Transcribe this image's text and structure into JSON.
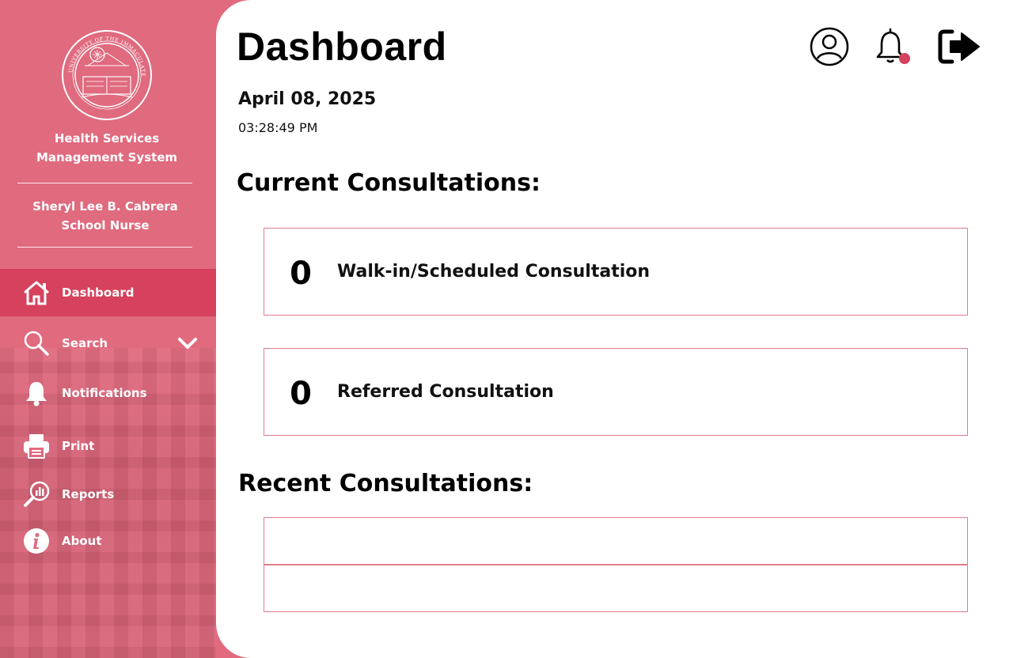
{
  "sidebar": {
    "logo_text": "UNIVERSITY OF THE IMMACULATE CONCEPTION · DAVAO · 1905 · CITY",
    "system_title_line1": "Health Services",
    "system_title_line2": "Management System",
    "user_name": "Sheryl Lee B. Cabrera",
    "user_role": "School Nurse",
    "nav": [
      {
        "label": "Dashboard",
        "icon": "home-icon",
        "active": true
      },
      {
        "label": "Search",
        "icon": "search-icon",
        "active": false
      },
      {
        "label": "Notifications",
        "icon": "bell-icon",
        "active": false
      },
      {
        "label": "Print",
        "icon": "printer-icon",
        "active": false
      },
      {
        "label": "Reports",
        "icon": "reports-icon",
        "active": false
      },
      {
        "label": "About",
        "icon": "info-icon",
        "active": false
      }
    ]
  },
  "header": {
    "title": "Dashboard",
    "icons": [
      "user-profile-icon",
      "notification-bell-icon",
      "logout-icon"
    ]
  },
  "datetime": {
    "date": "April 08, 2025",
    "time": "03:28:49 PM"
  },
  "current": {
    "title": "Current Consultations:",
    "cards": [
      {
        "count": "0",
        "label": "Walk-in/Scheduled Consultation"
      },
      {
        "count": "0",
        "label": "Referred Consultation"
      }
    ]
  },
  "recent": {
    "title": "Recent Consultations:",
    "rows": [
      "",
      ""
    ]
  },
  "colors": {
    "sidebar": "#e06a7e",
    "active_nav": "#d6415d",
    "card_border": "#e07c8d",
    "badge": "#d6415d"
  }
}
